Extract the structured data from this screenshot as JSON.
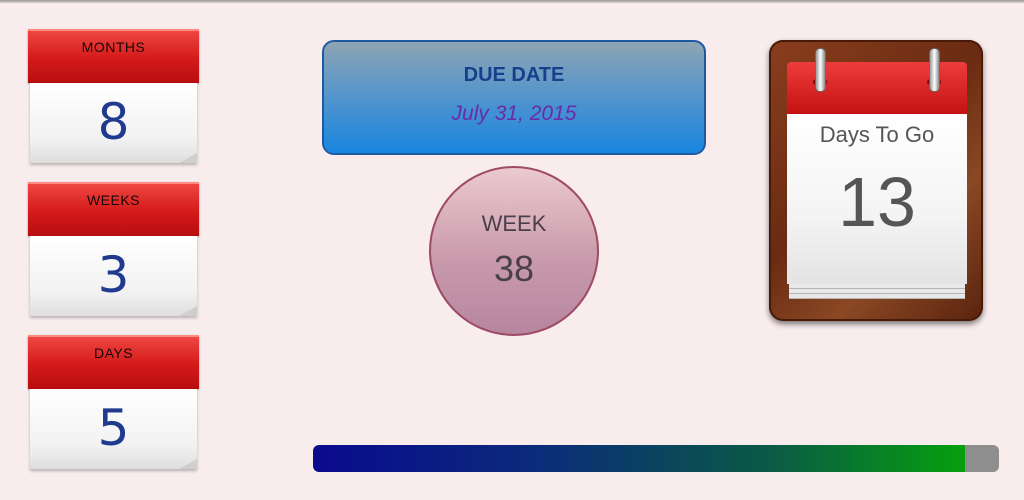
{
  "counters": [
    {
      "label": "MONTHS",
      "value": "8"
    },
    {
      "label": "WEEKS",
      "value": "3"
    },
    {
      "label": "DAYS",
      "value": "5"
    }
  ],
  "due_date": {
    "title": "DUE DATE",
    "date": "July 31, 2015"
  },
  "week": {
    "label": "WEEK",
    "number": "38"
  },
  "days_to_go": {
    "label": "Days To Go",
    "number": "13"
  },
  "progress": {
    "fraction": 0.95
  },
  "colors": {
    "accent_red": "#d41a1a",
    "value_blue": "#1f3a8f",
    "date_purple": "#6a2ba8",
    "progress_start": "#0a0a8e",
    "progress_end": "#06a00e"
  },
  "icons": {
    "desk_calendar": "calendar-icon"
  }
}
